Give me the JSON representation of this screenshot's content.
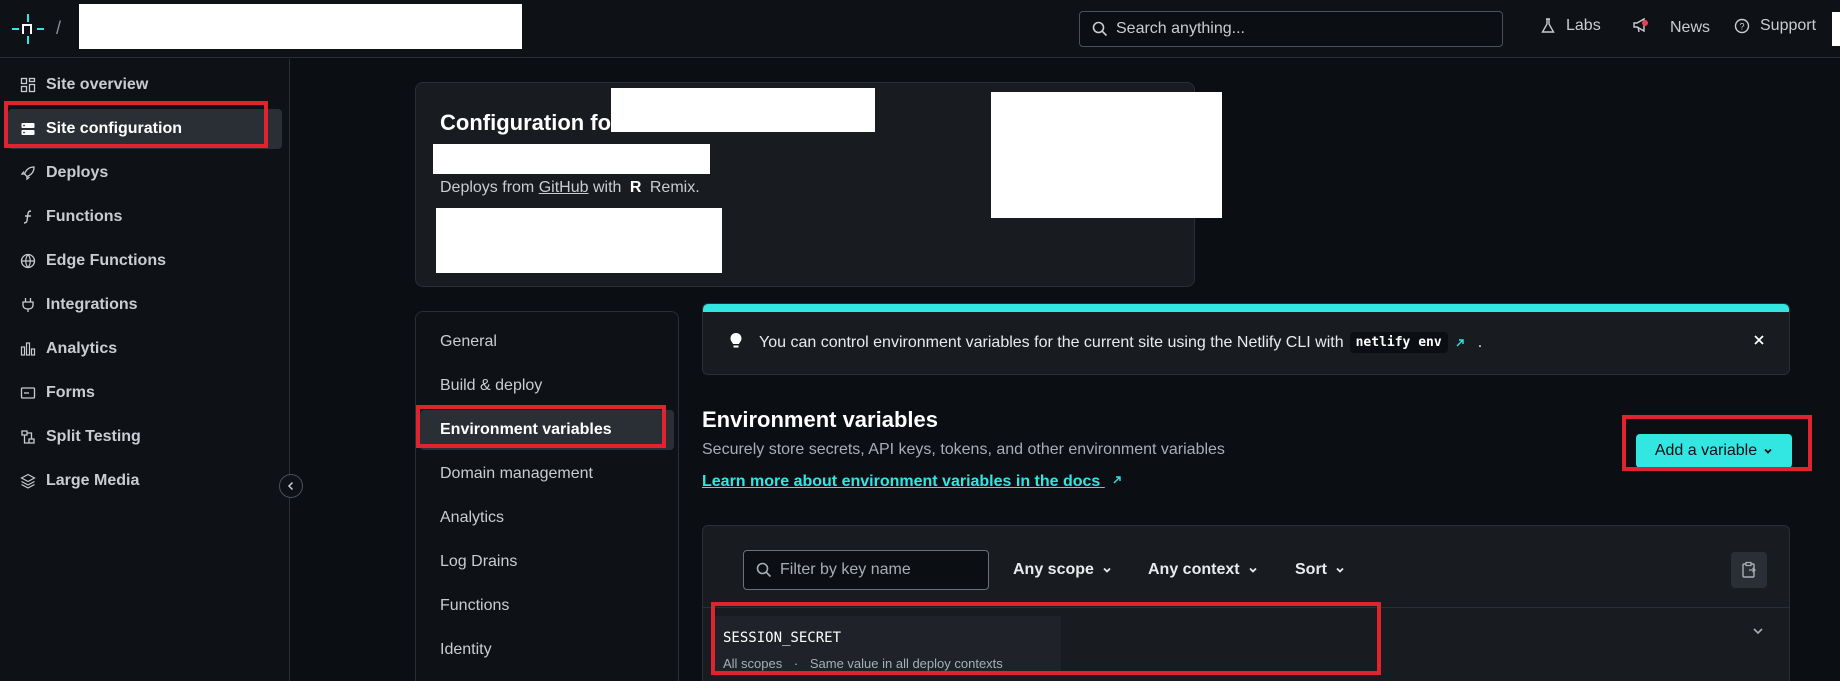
{
  "topbar": {
    "separator": "/",
    "search_placeholder": "Search anything...",
    "labs": "Labs",
    "news": "News",
    "support": "Support"
  },
  "sidebar": {
    "items": [
      {
        "label": "Site overview",
        "icon": "grid-icon"
      },
      {
        "label": "Site configuration",
        "icon": "server-icon",
        "active": true
      },
      {
        "label": "Deploys",
        "icon": "rocket-icon"
      },
      {
        "label": "Functions",
        "icon": "function-icon"
      },
      {
        "label": "Edge Functions",
        "icon": "globe-icon"
      },
      {
        "label": "Integrations",
        "icon": "plug-icon"
      },
      {
        "label": "Analytics",
        "icon": "bar-chart-icon"
      },
      {
        "label": "Forms",
        "icon": "form-icon"
      },
      {
        "label": "Split Testing",
        "icon": "split-icon"
      },
      {
        "label": "Large Media",
        "icon": "media-icon"
      }
    ]
  },
  "header": {
    "title": "Configuration for",
    "deploys_prefix": "Deploys from",
    "repo_host": "GitHub",
    "with_text": "with",
    "framework": "Remix."
  },
  "config_menu": {
    "items": [
      {
        "label": "General"
      },
      {
        "label": "Build & deploy"
      },
      {
        "label": "Environment variables",
        "active": true
      },
      {
        "label": "Domain management"
      },
      {
        "label": "Analytics"
      },
      {
        "label": "Log Drains"
      },
      {
        "label": "Functions"
      },
      {
        "label": "Identity"
      }
    ]
  },
  "banner": {
    "text": "You can control environment variables for the current site using the Netlify CLI with",
    "code": "netlify env",
    "suffix": ".",
    "accent_color": "#32e6e2"
  },
  "env": {
    "title": "Environment variables",
    "description": "Securely store secrets, API keys, tokens, and other environment variables",
    "docs_link": "Learn more about environment variables in the docs",
    "add_button": "Add a variable"
  },
  "vars_table": {
    "filter_placeholder": "Filter by key name",
    "scope_filter": "Any scope",
    "context_filter": "Any context",
    "sort": "Sort",
    "rows": [
      {
        "key": "SESSION_SECRET",
        "scopes": "All scopes",
        "separator": "·",
        "context": "Same value in all deploy contexts"
      }
    ]
  },
  "colors": {
    "accent": "#32e6e2",
    "highlight": "#e0242f",
    "background": "#0b0e12"
  }
}
